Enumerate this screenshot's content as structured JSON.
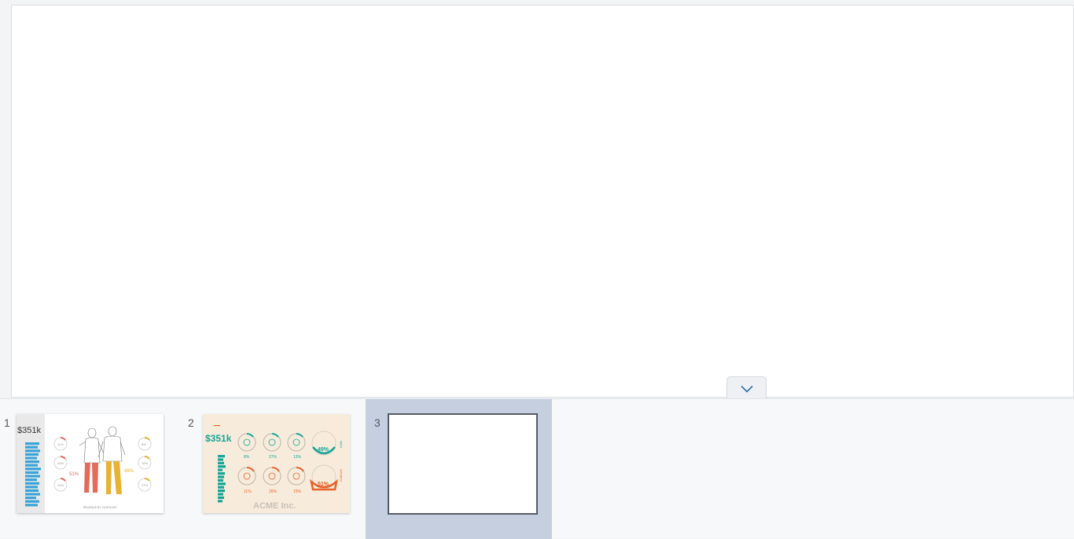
{
  "pages": [
    {
      "number": "1",
      "kpi": "$351k",
      "pct_left": "51%",
      "pct_right": "49%",
      "footer": "REVENUE BY CATEGORY",
      "percentages": [
        "11%",
        "26%",
        "14%",
        "8%",
        "15%",
        "27%"
      ],
      "selected": false
    },
    {
      "number": "2",
      "kpi": "$351k",
      "pct_men": "49%",
      "pct_women": "51%",
      "brand": "ACME Inc.",
      "row1": [
        "8%",
        "27%",
        "13%"
      ],
      "row2": [
        "11%",
        "26%",
        "15%"
      ],
      "side_men": "MEN",
      "side_women": "WOMEN",
      "selected": false
    },
    {
      "number": "3",
      "selected": true
    }
  ],
  "icons": {
    "collapse": "chevron-down-icon"
  },
  "colors": {
    "accent_teal": "#16a596",
    "accent_orange": "#e8622a",
    "bar_blue": "#3aa3d8",
    "selected_bg": "#c5cfe0"
  }
}
